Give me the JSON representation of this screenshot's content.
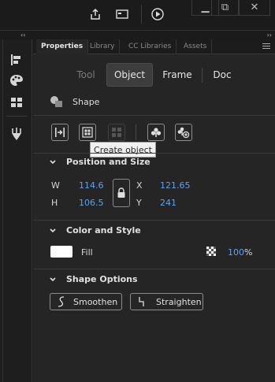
{
  "window": {
    "controls": {
      "minimize": "▁",
      "restore": "⧉",
      "close": "✕"
    }
  },
  "collapse": {
    "left": "‹‹",
    "right": "››"
  },
  "tabs": [
    {
      "label": "Properties",
      "active": true
    },
    {
      "label": "Library",
      "active": false
    },
    {
      "label": "CC Libraries",
      "active": false
    },
    {
      "label": "Assets",
      "active": false
    }
  ],
  "mode": {
    "items": [
      {
        "label": "Tool",
        "state": "disabled"
      },
      {
        "label": "Object",
        "state": "active"
      },
      {
        "label": "Frame",
        "state": "normal"
      },
      {
        "label": "Doc",
        "state": "normal"
      }
    ]
  },
  "object": {
    "type_label": "Shape"
  },
  "toolbar": {
    "tooltip": "Create object",
    "icons": [
      "distribute-icon",
      "create-object-icon",
      "ungroup-icon",
      "clubs-symbol-icon",
      "convert-to-symbol-icon"
    ]
  },
  "position_size": {
    "title": "Position and Size",
    "w_label": "W",
    "w_value": "114.6",
    "h_label": "H",
    "h_value": "106.5",
    "x_label": "X",
    "x_value": "121.65",
    "y_label": "Y",
    "y_value": "241"
  },
  "color_style": {
    "title": "Color and Style",
    "fill_label": "Fill",
    "fill_color": "#ffffff",
    "opacity_value": "100",
    "opacity_unit": "%"
  },
  "shape_options": {
    "title": "Shape Options",
    "smoothen_label": "Smoothen",
    "straighten_label": "Straighten"
  },
  "colors": {
    "accent_value": "#5fa2e8",
    "panel_bg": "#252525"
  }
}
